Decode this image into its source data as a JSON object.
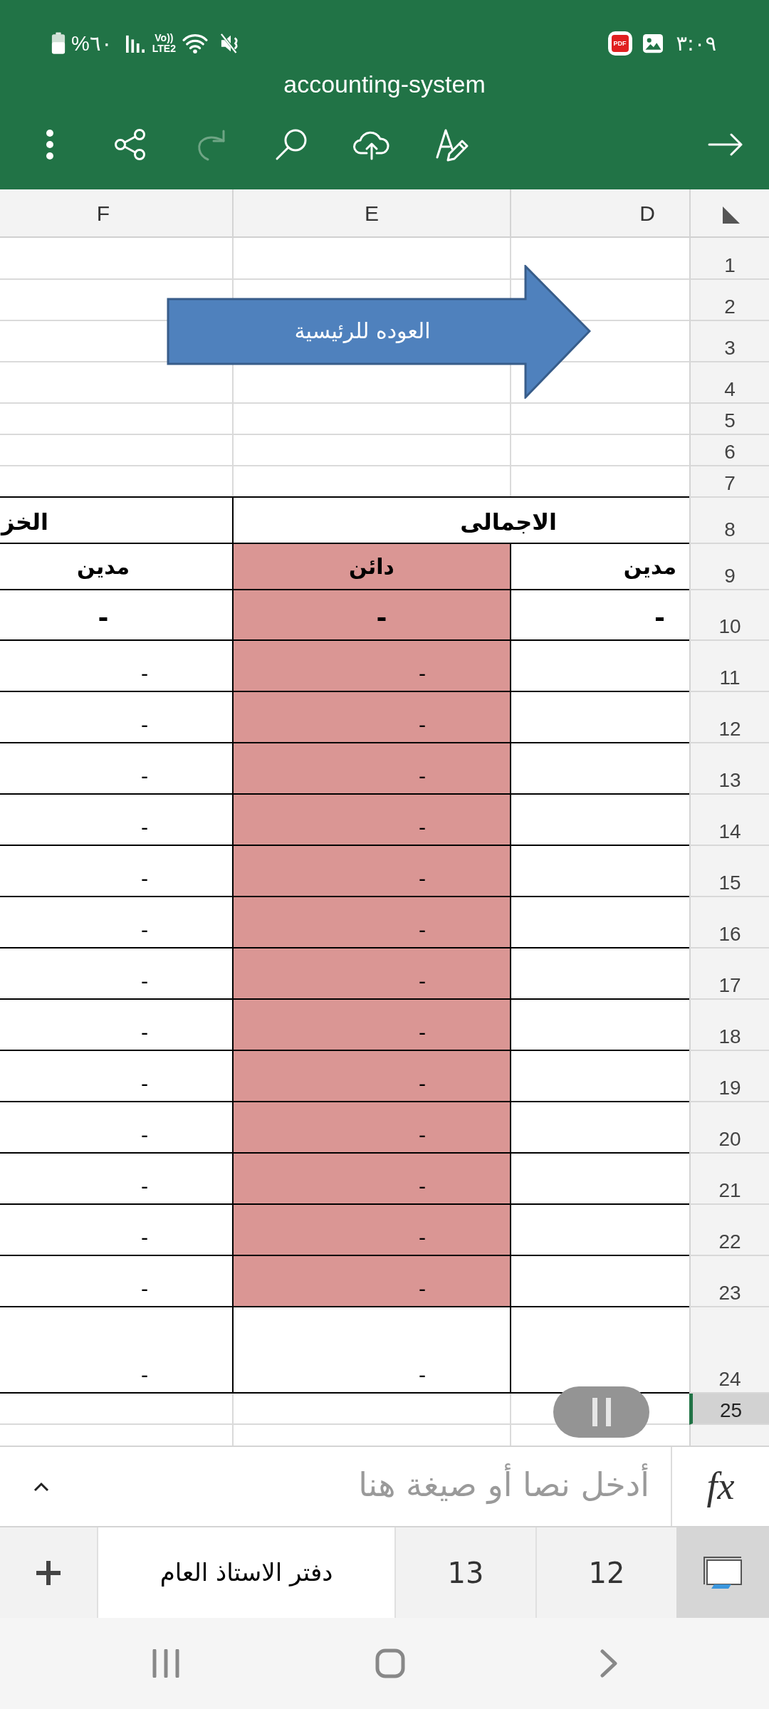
{
  "status_bar": {
    "battery": "%٦٠",
    "volte": "Vo))",
    "network_type": "LTE2",
    "notifications": [
      {
        "kind": "pdf",
        "label": "PDF"
      },
      {
        "kind": "gallery"
      }
    ],
    "time": "٣:٠٩"
  },
  "title_bar": {
    "title": "accounting-system"
  },
  "toolbar": [
    {
      "kind": "more",
      "disabled": false
    },
    {
      "kind": "share",
      "disabled": false
    },
    {
      "kind": "redo",
      "disabled": true
    },
    {
      "kind": "search",
      "disabled": false
    },
    {
      "kind": "upload",
      "disabled": false
    },
    {
      "kind": "draw",
      "disabled": false
    },
    {
      "kind": "forward",
      "disabled": false
    }
  ],
  "sheet": {
    "columns": [
      "D",
      "E",
      "F"
    ],
    "shape": {
      "label": "العوده للرئيسية"
    },
    "rows": [
      {
        "number": "1",
        "kind": "blank",
        "selected": false
      },
      {
        "number": "2",
        "kind": "blank",
        "selected": false
      },
      {
        "number": "3",
        "kind": "blank",
        "selected": false
      },
      {
        "number": "4",
        "kind": "blank",
        "selected": false
      },
      {
        "number": "5",
        "kind": "blank",
        "selected": false
      },
      {
        "number": "6",
        "kind": "blank",
        "selected": false
      },
      {
        "number": "7",
        "kind": "blank",
        "selected": false
      },
      {
        "number": "8",
        "kind": "title",
        "selected": false,
        "cells": [
          {
            "text": "الاجمالى",
            "shaded": false
          },
          {
            "text": "الخز",
            "shaded": false
          }
        ]
      },
      {
        "number": "9",
        "kind": "header",
        "selected": false,
        "cells": [
          {
            "text": "مدين",
            "shaded": false
          },
          {
            "text": "دائن",
            "shaded": true
          },
          {
            "text": "مدين",
            "shaded": false
          }
        ]
      },
      {
        "number": "10",
        "kind": "total",
        "selected": false,
        "cells": [
          {
            "text": "-",
            "shaded": false
          },
          {
            "text": "-",
            "shaded": true
          },
          {
            "text": "-",
            "shaded": false
          }
        ]
      },
      {
        "number": "11",
        "kind": "entry",
        "selected": false,
        "cells": [
          {
            "shaded": false
          },
          {
            "text": "-",
            "shaded": true
          },
          {
            "text": "-",
            "shaded": false
          }
        ]
      },
      {
        "number": "12",
        "kind": "entry",
        "selected": false,
        "cells": [
          {
            "shaded": false
          },
          {
            "text": "-",
            "shaded": true
          },
          {
            "text": "-",
            "shaded": false
          }
        ]
      },
      {
        "number": "13",
        "kind": "entry",
        "selected": false,
        "cells": [
          {
            "shaded": false
          },
          {
            "text": "-",
            "shaded": true
          },
          {
            "text": "-",
            "shaded": false
          }
        ]
      },
      {
        "number": "14",
        "kind": "entry",
        "selected": false,
        "cells": [
          {
            "shaded": false
          },
          {
            "text": "-",
            "shaded": true
          },
          {
            "text": "-",
            "shaded": false
          }
        ]
      },
      {
        "number": "15",
        "kind": "entry",
        "selected": false,
        "cells": [
          {
            "shaded": false
          },
          {
            "text": "-",
            "shaded": true
          },
          {
            "text": "-",
            "shaded": false
          }
        ]
      },
      {
        "number": "16",
        "kind": "entry",
        "selected": false,
        "cells": [
          {
            "shaded": false
          },
          {
            "text": "-",
            "shaded": true
          },
          {
            "text": "-",
            "shaded": false
          }
        ]
      },
      {
        "number": "17",
        "kind": "entry",
        "selected": false,
        "cells": [
          {
            "shaded": false
          },
          {
            "text": "-",
            "shaded": true
          },
          {
            "text": "-",
            "shaded": false
          }
        ]
      },
      {
        "number": "18",
        "kind": "entry",
        "selected": false,
        "cells": [
          {
            "shaded": false
          },
          {
            "text": "-",
            "shaded": true
          },
          {
            "text": "-",
            "shaded": false
          }
        ]
      },
      {
        "number": "19",
        "kind": "entry",
        "selected": false,
        "cells": [
          {
            "shaded": false
          },
          {
            "text": "-",
            "shaded": true
          },
          {
            "text": "-",
            "shaded": false
          }
        ]
      },
      {
        "number": "20",
        "kind": "entry",
        "selected": false,
        "cells": [
          {
            "shaded": false
          },
          {
            "text": "-",
            "shaded": true
          },
          {
            "text": "-",
            "shaded": false
          }
        ]
      },
      {
        "number": "21",
        "kind": "entry",
        "selected": false,
        "cells": [
          {
            "shaded": false
          },
          {
            "text": "-",
            "shaded": true
          },
          {
            "text": "-",
            "shaded": false
          }
        ]
      },
      {
        "number": "22",
        "kind": "entry",
        "selected": false,
        "cells": [
          {
            "shaded": false
          },
          {
            "text": "-",
            "shaded": true
          },
          {
            "text": "-",
            "shaded": false
          }
        ]
      },
      {
        "number": "23",
        "kind": "entry",
        "selected": false,
        "cells": [
          {
            "shaded": false
          },
          {
            "text": "-",
            "shaded": true
          },
          {
            "text": "-",
            "shaded": false
          }
        ]
      },
      {
        "number": "24",
        "kind": "entry",
        "selected": false,
        "cells": [
          {
            "shaded": false
          },
          {
            "text": "-",
            "shaded": false
          },
          {
            "text": "-",
            "shaded": false
          }
        ]
      },
      {
        "number": "25",
        "kind": "blank",
        "selected": true
      }
    ]
  },
  "formula_bar": {
    "placeholder": "أدخل نصا أو صيغة هنا",
    "function_label": "fx"
  },
  "sheet_tabs": [
    {
      "label": "12",
      "selected": false
    },
    {
      "label": "13",
      "selected": false
    },
    {
      "label": "دفتر الاستاذ العام",
      "selected": true
    }
  ]
}
